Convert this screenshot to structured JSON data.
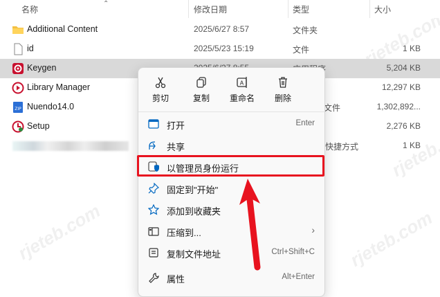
{
  "columns": {
    "name": "名称",
    "date": "修改日期",
    "type": "类型",
    "size": "大小"
  },
  "files": [
    {
      "name": "Additional Content",
      "date": "2025/6/27 8:57",
      "type": "文件夹",
      "size": "",
      "icon": "folder-icon"
    },
    {
      "name": "id",
      "date": "2025/5/23 15:19",
      "type": "文件",
      "size": "1 KB",
      "icon": "file-icon"
    },
    {
      "name": "Keygen",
      "date": "2025/6/27 8:55",
      "type": "应用程序",
      "size": "5,204 KB",
      "icon": "keygen-app-icon"
    },
    {
      "name": "Library Manager",
      "date": "",
      "type": "",
      "size": "12,297 KB",
      "icon": "library-manager-icon"
    },
    {
      "name": "Nuendo14.0",
      "date": "",
      "type": "文件",
      "size": "1,302,892...",
      "icon": "zip-archive-icon"
    },
    {
      "name": "Setup",
      "date": "",
      "type": "",
      "size": "2,276 KB",
      "icon": "setup-icon"
    },
    {
      "name": "",
      "date": "",
      "type": "快捷方式",
      "size": "1 KB",
      "icon": "shortcut-icon"
    }
  ],
  "context_menu": {
    "quick_actions": [
      {
        "label": "剪切",
        "icon": "scissors-icon"
      },
      {
        "label": "复制",
        "icon": "copy-icon"
      },
      {
        "label": "重命名",
        "icon": "rename-icon"
      },
      {
        "label": "删除",
        "icon": "trash-icon"
      }
    ],
    "items": [
      {
        "label": "打开",
        "shortcut": "Enter",
        "icon": "open-app-icon"
      },
      {
        "label": "共享",
        "shortcut": "",
        "icon": "share-icon"
      },
      {
        "label": "以管理员身份运行",
        "shortcut": "",
        "icon": "shield-icon"
      },
      {
        "label": "固定到\"开始\"",
        "shortcut": "",
        "icon": "pin-icon"
      },
      {
        "label": "添加到收藏夹",
        "shortcut": "",
        "icon": "star-icon"
      },
      {
        "label": "压缩到...",
        "shortcut": "",
        "icon": "compress-icon"
      },
      {
        "label": "复制文件地址",
        "shortcut": "Ctrl+Shift+C",
        "icon": "copy-path-icon"
      },
      {
        "label": "属性",
        "shortcut": "Alt+Enter",
        "icon": "properties-icon"
      }
    ]
  },
  "colors": {
    "highlight": "#e8131f",
    "selected_row": "#d9d9d9",
    "accent": "#0067c0"
  }
}
